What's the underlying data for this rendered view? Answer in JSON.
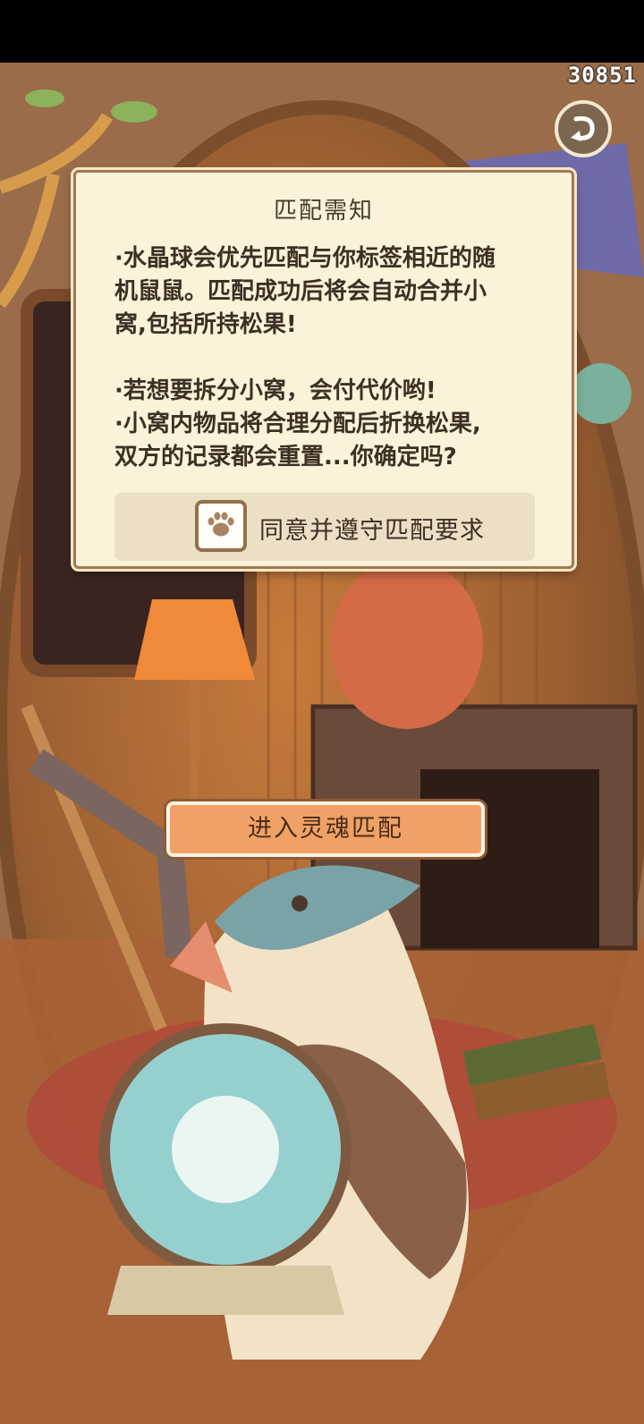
{
  "counter": "30851",
  "notice": {
    "title": "匹配需知",
    "line1": "·水晶球会优先匹配与你标签相近的随",
    "line2": "机鼠鼠。匹配成功后将会自动合并小",
    "line3": "窝,包括所持松果!",
    "line4": "·若想要拆分小窝，会付代价哟!",
    "line5": "·小窝内物品将合理分配后折换松果,",
    "line6": "双方的记录都会重置...你确定吗?"
  },
  "agree": {
    "label": "同意并遵守匹配要求",
    "checked": false
  },
  "enter_button": "进入灵魂匹配",
  "icons": {
    "back": "undo-arrow-icon",
    "checkbox": "paw-icon"
  },
  "colors": {
    "panel": "#fbf2da",
    "button": "#f0a266",
    "accent_border": "#a07a52"
  }
}
